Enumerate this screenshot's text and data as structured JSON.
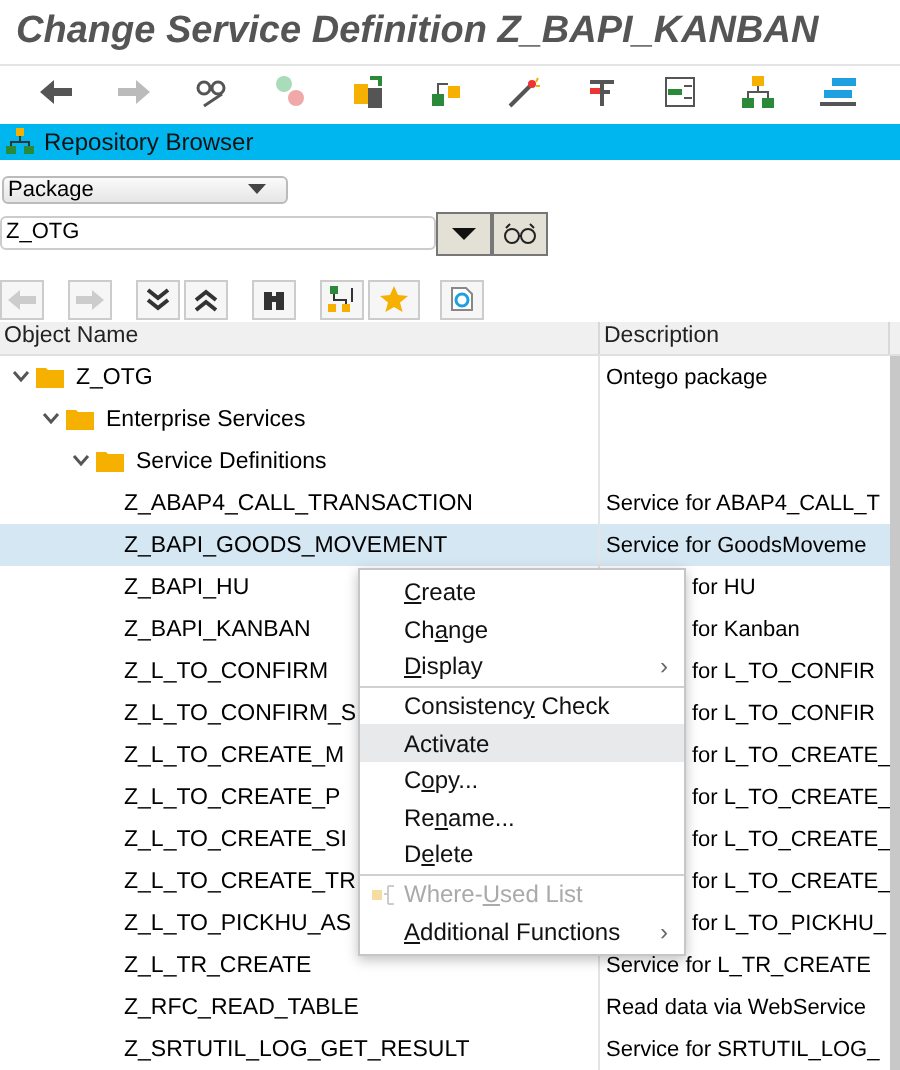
{
  "window": {
    "title": "Change Service Definition Z_BAPI_KANBAN"
  },
  "panel": {
    "title": "Repository Browser"
  },
  "object_type": {
    "value": "Package"
  },
  "object_name": {
    "value": "Z_OTG"
  },
  "table": {
    "columns": [
      "Object Name",
      "Description"
    ],
    "rows": [
      {
        "name": "Z_OTG",
        "description": "Ontego package",
        "kind": "folder",
        "expanded": true,
        "selected": false,
        "children": [
          {
            "name": "Enterprise Services",
            "kind": "folder",
            "expanded": true,
            "selected": false,
            "children": [
              {
                "name": "Service Definitions",
                "kind": "folder",
                "expanded": true,
                "selected": false,
                "children": [
                  {
                    "name": "Z_ABAP4_CALL_TRANSACTION",
                    "description": "Service for ABAP4_CALL_T",
                    "kind": "leaf",
                    "selected": false
                  },
                  {
                    "name": "Z_BAPI_GOODS_MOVEMENT",
                    "description": "Service for GoodsMoveme",
                    "kind": "leaf",
                    "selected": true
                  },
                  {
                    "name": "Z_BAPI_HU",
                    "description": "for HU",
                    "kind": "leaf",
                    "selected": false,
                    "under_menu": true
                  },
                  {
                    "name": "Z_BAPI_KANBAN",
                    "description": "for Kanban",
                    "kind": "leaf",
                    "selected": false,
                    "under_menu": true
                  },
                  {
                    "name": "Z_L_TO_CONFIRM",
                    "description": "for L_TO_CONFIR",
                    "kind": "leaf",
                    "selected": false,
                    "under_menu": true
                  },
                  {
                    "name": "Z_L_TO_CONFIRM_S",
                    "description": "for L_TO_CONFIR",
                    "kind": "leaf",
                    "selected": false,
                    "under_menu": true
                  },
                  {
                    "name": "Z_L_TO_CREATE_M",
                    "description": "for L_TO_CREATE_",
                    "kind": "leaf",
                    "selected": false,
                    "under_menu": true
                  },
                  {
                    "name": "Z_L_TO_CREATE_P",
                    "description": "for L_TO_CREATE_",
                    "kind": "leaf",
                    "selected": false,
                    "under_menu": true
                  },
                  {
                    "name": "Z_L_TO_CREATE_SI",
                    "description": "for L_TO_CREATE_",
                    "kind": "leaf",
                    "selected": false,
                    "under_menu": true
                  },
                  {
                    "name": "Z_L_TO_CREATE_TR",
                    "description": "for L_TO_CREATE_",
                    "kind": "leaf",
                    "selected": false,
                    "under_menu": true
                  },
                  {
                    "name": "Z_L_TO_PICKHU_AS",
                    "description": "for L_TO_PICKHU_",
                    "kind": "leaf",
                    "selected": false,
                    "under_menu": true
                  },
                  {
                    "name": "Z_L_TR_CREATE",
                    "description": "Service for L_TR_CREATE",
                    "kind": "leaf",
                    "selected": false
                  },
                  {
                    "name": "Z_RFC_READ_TABLE",
                    "description": "Read data via WebService",
                    "kind": "leaf",
                    "selected": false
                  },
                  {
                    "name": "Z_SRTUTIL_LOG_GET_RESULT",
                    "description": "Service for SRTUTIL_LOG_",
                    "kind": "leaf",
                    "selected": false
                  }
                ]
              }
            ]
          }
        ]
      }
    ]
  },
  "context_menu": {
    "items": [
      {
        "kind": "item",
        "key": "C",
        "post": "reate",
        "selected": false,
        "disabled": false
      },
      {
        "kind": "item",
        "pre": "Ch",
        "key": "a",
        "post": "nge",
        "selected": false,
        "disabled": false
      },
      {
        "kind": "submenu",
        "key": "D",
        "post": "isplay",
        "selected": false,
        "disabled": false,
        "arrow": "›"
      },
      {
        "kind": "separator"
      },
      {
        "kind": "item",
        "pre": "Consistenc",
        "key": "y",
        "post": " Check",
        "selected": false,
        "disabled": false
      },
      {
        "kind": "item",
        "pre": "Activate",
        "selected": true,
        "disabled": false
      },
      {
        "kind": "item",
        "pre": "C",
        "key": "o",
        "post": "py...",
        "selected": false,
        "disabled": false
      },
      {
        "kind": "item",
        "pre": "Re",
        "key": "n",
        "post": "ame...",
        "selected": false,
        "disabled": false
      },
      {
        "kind": "item",
        "pre": "D",
        "key": "e",
        "post": "lete",
        "selected": false,
        "disabled": false
      },
      {
        "kind": "separator"
      },
      {
        "kind": "item",
        "pre": "Where-",
        "key": "U",
        "post": "sed List",
        "selected": false,
        "disabled": true
      },
      {
        "kind": "submenu",
        "key": "A",
        "post": "dditional Functions",
        "selected": false,
        "disabled": false,
        "arrow": "›"
      }
    ]
  }
}
